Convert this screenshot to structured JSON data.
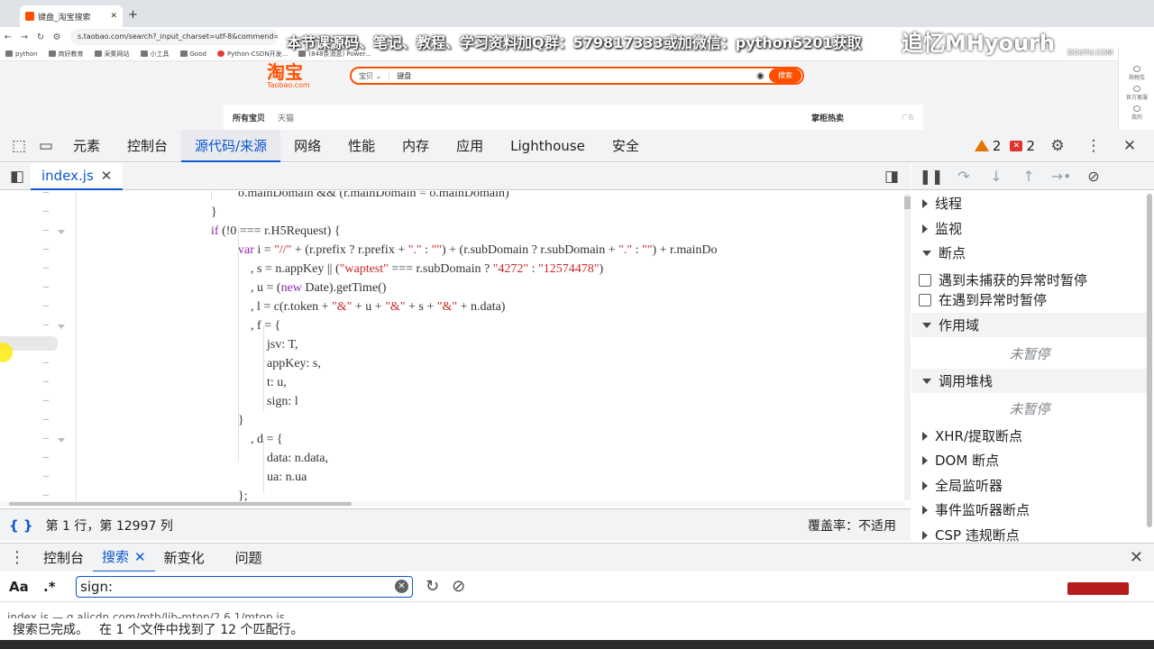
{
  "browser": {
    "tab_title": "键盘_淘宝搜索",
    "new_tab": "+",
    "url": "s.taobao.com/search?_input_charset=utf-8&commend=all&ie=utf8&initiative_id",
    "bookmarks": [
      "python",
      "商好教育",
      "采集网站",
      "小工具",
      "Good",
      "Python-CSDN开发...",
      "(848条消息) Power..."
    ]
  },
  "overlay": {
    "banner": "本节课源码、笔记、教程、学习资料加Q群：579817333或加微信：python5201获取",
    "watermark": "追忆MHyourh",
    "watermark_sub": "DOUYU.COM"
  },
  "taobao": {
    "logo": "淘宝",
    "logo_sub": "Taobao.com",
    "search_category": "宝贝 ⌄",
    "search_query": "键盘",
    "search_button": "搜索",
    "tabs": [
      "所有宝贝",
      "天猫"
    ],
    "right_label": "掌柜热卖",
    "ad_tag": "广告",
    "side_items": [
      "购物车",
      "官方客服",
      "我的"
    ]
  },
  "devtools": {
    "tabs": [
      "元素",
      "控制台",
      "源代码/来源",
      "网络",
      "性能",
      "内存",
      "应用",
      "Lighthouse",
      "安全"
    ],
    "active_tab": "源代码/来源",
    "warnings": "2",
    "errors": "2",
    "open_file": "index.js"
  },
  "code": {
    "lines": [
      "o.mainDomain && (r.mainDomain = o.mainDomain)",
      "}",
      "if (!0 === r.H5Request) {",
      "var i = \"//\" + (r.prefix ? r.prefix + \".\" : \"\") + (r.subDomain ? r.subDomain + \".\" : \"\") + r.mainDo",
      ", s = n.appKey || (\"waptest\" === r.subDomain ? \"4272\" : \"12574478\")",
      ", u = (new Date).getTime()",
      ", l = c(r.token + \"&\" + u + \"&\" + s + \"&\" + n.data)",
      ", f = {",
      "jsv: T,",
      "appKey: s,",
      "t: u,",
      "sign: l",
      "}",
      ", d = {",
      "data: n.data,",
      "ua: n.ua",
      "};"
    ]
  },
  "status": {
    "position": "第 1 行，第 12997 列",
    "coverage": "覆盖率：不适用"
  },
  "sidebar": {
    "threads": "线程",
    "watch": "监视",
    "breakpoints": "断点",
    "pause_uncaught": "遇到未捕获的异常时暂停",
    "pause_caught": "在遇到异常时暂停",
    "scope": "作用域",
    "not_paused": "未暂停",
    "call_stack": "调用堆栈",
    "not_paused_2": "未暂停",
    "xhr": "XHR/提取断点",
    "dom": "DOM 断点",
    "global_listeners": "全局监听器",
    "event_breakpoints": "事件监听器断点",
    "csp": "CSP 违规断点"
  },
  "drawer": {
    "tabs": [
      "控制台",
      "搜索",
      "新变化",
      "问题"
    ],
    "active_tab": "搜索",
    "case_option": "Aa",
    "regex_option": ".*",
    "search_value": "sign:",
    "result_peek": "index.js — g.alicdn.com/mtb/lib-mtop/2.6.1/mtop.js",
    "result_status": "搜索已完成。",
    "result_count": "在 1 个文件中找到了 12 个匹配行。"
  }
}
